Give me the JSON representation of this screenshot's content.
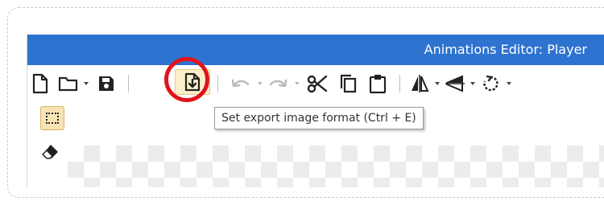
{
  "window": {
    "title": "Animations Editor: Player"
  },
  "toolbar": {
    "buttons": [
      {
        "name": "new-document",
        "icon": "new-file-icon"
      },
      {
        "name": "open",
        "icon": "folder-icon",
        "has_dropdown": true
      },
      {
        "name": "save",
        "icon": "floppy-disk-icon"
      },
      {
        "name": "export-image-format",
        "icon": "export-file-icon",
        "highlighted": true
      },
      {
        "name": "undo",
        "icon": "undo-icon",
        "has_dropdown": true,
        "disabled": true
      },
      {
        "name": "redo",
        "icon": "redo-icon",
        "has_dropdown": true,
        "disabled": true
      },
      {
        "name": "cut",
        "icon": "scissors-icon"
      },
      {
        "name": "copy",
        "icon": "copy-icon"
      },
      {
        "name": "paste",
        "icon": "clipboard-icon"
      },
      {
        "name": "flip-horizontal",
        "icon": "flip-horizontal-icon",
        "has_dropdown": true
      },
      {
        "name": "flip-vertical",
        "icon": "flip-vertical-icon",
        "has_dropdown": true
      },
      {
        "name": "rotate",
        "icon": "rotate-icon",
        "has_dropdown": true
      }
    ]
  },
  "tooltip": {
    "text": "Set export image format (Ctrl + E)"
  },
  "tools": [
    {
      "name": "rectangle-select",
      "icon": "marquee-select-icon",
      "selected": true
    },
    {
      "name": "eraser",
      "icon": "eraser-icon",
      "selected": false
    }
  ],
  "colors": {
    "titlebar": "#2f73d0",
    "highlight_ring": "#e1141b",
    "selected_tool_bg": "#f7e3b4",
    "hovered_button_bg": "#fbefc8"
  }
}
